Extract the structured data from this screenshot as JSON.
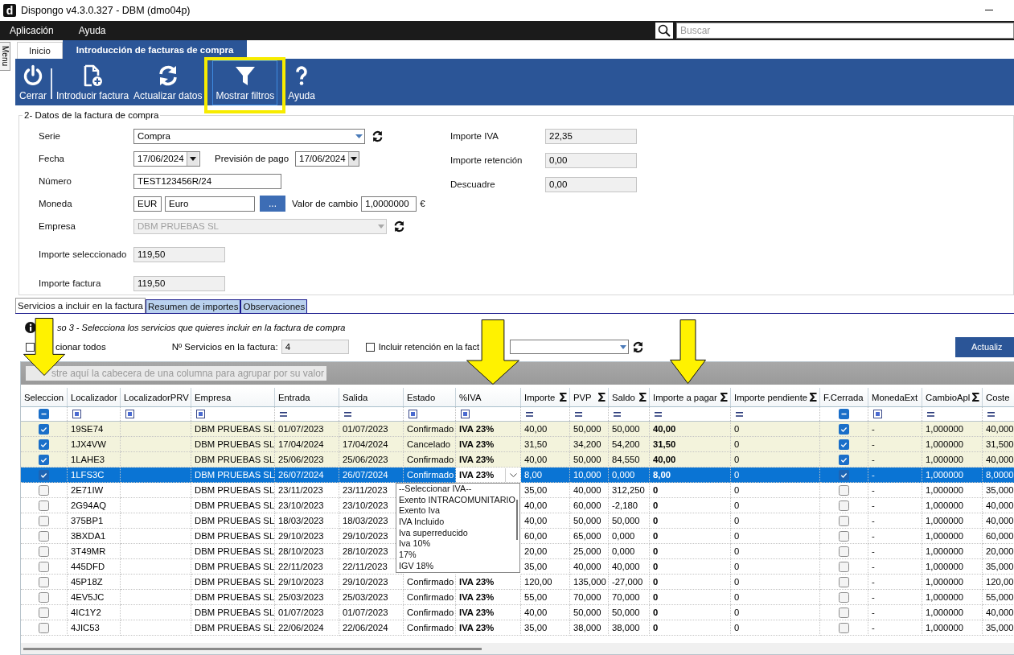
{
  "window": {
    "title": "Dispongo v4.3.0.327 - DBM (dmo04p)",
    "logo": "d"
  },
  "menu": [
    "Aplicación",
    "Ayuda"
  ],
  "search": {
    "placeholder": "Buscar"
  },
  "side_tab": "Menu",
  "tabs": [
    {
      "label": "Inicio",
      "selected": false
    },
    {
      "label": "Introducción de facturas de compra",
      "selected": true
    }
  ],
  "toolbar": [
    {
      "kind": "power",
      "label": "Cerrar",
      "highlighted": false
    },
    {
      "kind": "separator"
    },
    {
      "kind": "new-doc",
      "label": "Introducir factura",
      "highlighted": false
    },
    {
      "kind": "refresh",
      "label": "Actualizar datos",
      "highlighted": false
    },
    {
      "kind": "filter",
      "label": "Mostrar filtros",
      "highlighted": true
    },
    {
      "kind": "help",
      "label": "Ayuda",
      "highlighted": false
    }
  ],
  "form": {
    "title": "2- Datos de la factura de compra",
    "serie": {
      "label": "Serie",
      "value": "Compra"
    },
    "fecha": {
      "label": "Fecha",
      "value": "17/06/2024"
    },
    "prevision": {
      "label": "Previsión de pago",
      "value": "17/06/2024"
    },
    "numero": {
      "label": "Número",
      "value": "TEST123456R/24"
    },
    "moneda": {
      "label": "Moneda",
      "code": "EUR",
      "name": "Euro",
      "button": "..."
    },
    "cambio": {
      "label": "Valor de cambio",
      "value": "1,0000000",
      "symbol": "€"
    },
    "empresa": {
      "label": "Empresa",
      "value": "DBM PRUEBAS SL",
      "disabled": true
    },
    "importe_seleccionado": {
      "label": "Importe seleccionado",
      "value": "119,50"
    },
    "importe_factura": {
      "label": "Importe factura",
      "value": "119,50"
    },
    "importe_iva": {
      "label": "Importe IVA",
      "value": "22,35"
    },
    "importe_retencion": {
      "label": "Importe retención",
      "value": "0,00"
    },
    "descuadre": {
      "label": "Descuadre",
      "value": "0,00"
    }
  },
  "lower_tabs": [
    {
      "label": "Servicios a incluir en la factura",
      "selected": true
    },
    {
      "label": "Resumen de importes",
      "selected": false
    },
    {
      "label": "Observaciones",
      "selected": false
    }
  ],
  "info": "so 3 - Selecciona los servicios que quieres incluir en la factura de compra",
  "select_all": {
    "label": "cionar todos",
    "checked": false
  },
  "service_count": {
    "label": "Nº Servicios en la factura:",
    "value": "4"
  },
  "retention": {
    "label": "Incluir retención en la fact",
    "checked": false
  },
  "update_button": "Actualiz",
  "group_panel": {
    "placeholder": "stre aquí la cabecera de una columna para agrupar por su valor"
  },
  "columns": [
    {
      "title": "Seleccion",
      "kind": "check"
    },
    {
      "title": "Localizador",
      "kind": "list"
    },
    {
      "title": "LocalizadorPRV",
      "kind": "list"
    },
    {
      "title": "Empresa",
      "kind": "list"
    },
    {
      "title": "Entrada",
      "kind": "equals"
    },
    {
      "title": "Salida",
      "kind": "equals"
    },
    {
      "title": "Estado",
      "kind": "list"
    },
    {
      "title": "%IVA",
      "kind": "list"
    },
    {
      "title": "Importe",
      "kind": "equals",
      "sum": true
    },
    {
      "title": "PVP",
      "kind": "equals",
      "sum": true
    },
    {
      "title": "Saldo",
      "kind": "equals",
      "sum": true
    },
    {
      "title": "Importe a pagar",
      "kind": "equals",
      "sum": true
    },
    {
      "title": "Importe pendiente",
      "kind": "equals",
      "sum": true
    },
    {
      "title": "F.Cerrada",
      "kind": "check"
    },
    {
      "title": "MonedaExt",
      "kind": "list"
    },
    {
      "title": "CambioApl",
      "kind": "equals",
      "sum": true
    },
    {
      "title": "Coste",
      "kind": "equals"
    }
  ],
  "rows": [
    {
      "sel": true,
      "current": false,
      "loc": "19SE74",
      "emp": "DBM PRUEBAS SL",
      "ent": "01/07/2023",
      "sal": "01/07/2023",
      "est": "Confirmado",
      "iva": "IVA 23%",
      "imp": "40,00",
      "pvp": "50,000",
      "saldo": "50,000",
      "pagar": "40,00",
      "pend": "0",
      "cerrada": true,
      "mon": "-",
      "camb": "1,000000",
      "coste": "40,000"
    },
    {
      "sel": true,
      "current": false,
      "loc": "1JX4VW",
      "emp": "DBM PRUEBAS SL",
      "ent": "17/04/2024",
      "sal": "17/04/2024",
      "est": "Cancelado",
      "iva": "IVA 23%",
      "imp": "31,50",
      "pvp": "34,200",
      "saldo": "54,200",
      "pagar": "31,50",
      "pend": "0",
      "cerrada": true,
      "mon": "-",
      "camb": "1,000000",
      "coste": "31,500"
    },
    {
      "sel": true,
      "current": false,
      "loc": "1LAHE3",
      "emp": "DBM PRUEBAS SL",
      "ent": "25/06/2023",
      "sal": "25/06/2023",
      "est": "Confirmado",
      "iva": "IVA 23%",
      "imp": "40,00",
      "pvp": "50,000",
      "saldo": "84,550",
      "pagar": "40,00",
      "pend": "0",
      "cerrada": true,
      "mon": "-",
      "camb": "1,000000",
      "coste": "40,000"
    },
    {
      "sel": true,
      "current": true,
      "loc": "1LFS3C",
      "emp": "DBM PRUEBAS SL",
      "ent": "26/07/2024",
      "sal": "26/07/2024",
      "est": "Confirmado",
      "iva": "IVA 23%",
      "imp": "8,00",
      "pvp": "10,000",
      "saldo": "0,000",
      "pagar": "8,00",
      "pend": "0",
      "cerrada": true,
      "mon": "-",
      "camb": "1,000000",
      "coste": "8,0000"
    },
    {
      "sel": false,
      "current": false,
      "loc": "2E71IW",
      "emp": "DBM PRUEBAS SL",
      "ent": "23/11/2023",
      "sal": "23/11/2023",
      "imp": "35,00",
      "pvp": "40,000",
      "saldo": "312,250",
      "pagar": "0",
      "pend": "0",
      "cerrada": false,
      "mon": "-",
      "camb": "1,000000",
      "coste": "35,000"
    },
    {
      "sel": false,
      "current": false,
      "loc": "2G94AQ",
      "emp": "DBM PRUEBAS SL",
      "ent": "23/10/2023",
      "sal": "23/10/2023",
      "imp": "40,00",
      "pvp": "60,000",
      "saldo": "-2,180",
      "pagar": "0",
      "pend": "0",
      "cerrada": false,
      "mon": "-",
      "camb": "1,000000",
      "coste": "40,000"
    },
    {
      "sel": false,
      "current": false,
      "loc": "375BP1",
      "emp": "DBM PRUEBAS SL",
      "ent": "18/03/2023",
      "sal": "18/03/2023",
      "imp": "40,00",
      "pvp": "50,000",
      "saldo": "50,000",
      "pagar": "0",
      "pend": "0",
      "cerrada": false,
      "mon": "-",
      "camb": "1,000000",
      "coste": "40,000"
    },
    {
      "sel": false,
      "current": false,
      "loc": "3BXDA1",
      "emp": "DBM PRUEBAS SL",
      "ent": "29/10/2023",
      "sal": "29/10/2023",
      "imp": "60,00",
      "pvp": "65,000",
      "saldo": "0,000",
      "pagar": "0",
      "pend": "0",
      "cerrada": false,
      "mon": "-",
      "camb": "1,000000",
      "coste": "60,000"
    },
    {
      "sel": false,
      "current": false,
      "loc": "3T49MR",
      "emp": "DBM PRUEBAS SL",
      "ent": "28/10/2023",
      "sal": "28/10/2023",
      "imp": "20,00",
      "pvp": "25,000",
      "saldo": "0,000",
      "pagar": "0",
      "pend": "0",
      "cerrada": false,
      "mon": "-",
      "camb": "1,000000",
      "coste": "20,000"
    },
    {
      "sel": false,
      "current": false,
      "loc": "445DFD",
      "emp": "DBM PRUEBAS SL",
      "ent": "22/11/2023",
      "sal": "22/11/2023",
      "imp": "35,00",
      "pvp": "40,000",
      "saldo": "40,000",
      "pagar": "0",
      "pend": "0",
      "cerrada": false,
      "mon": "-",
      "camb": "1,000000",
      "coste": "35,000"
    },
    {
      "sel": false,
      "current": false,
      "loc": "45P18Z",
      "emp": "DBM PRUEBAS SL",
      "ent": "29/10/2023",
      "sal": "29/10/2023",
      "est": "Confirmado",
      "iva": "IVA 23%",
      "imp": "120,00",
      "pvp": "135,000",
      "saldo": "-27,000",
      "pagar": "0",
      "pend": "0",
      "cerrada": false,
      "mon": "-",
      "camb": "1,000000",
      "coste": "120,00"
    },
    {
      "sel": false,
      "current": false,
      "loc": "4EV5JC",
      "emp": "DBM PRUEBAS SL",
      "ent": "25/03/2023",
      "sal": "25/03/2023",
      "est": "Confirmado",
      "iva": "IVA 23%",
      "imp": "55,00",
      "pvp": "70,000",
      "saldo": "70,000",
      "pagar": "0",
      "pend": "0",
      "cerrada": false,
      "mon": "-",
      "camb": "1,000000",
      "coste": "55,000"
    },
    {
      "sel": false,
      "current": false,
      "loc": "4IC1Y2",
      "emp": "DBM PRUEBAS SL",
      "ent": "01/07/2023",
      "sal": "01/07/2023",
      "est": "Confirmado",
      "iva": "IVA 23%",
      "imp": "40,00",
      "pvp": "50,000",
      "saldo": "50,000",
      "pagar": "0",
      "pend": "0",
      "cerrada": false,
      "mon": "-",
      "camb": "1,000000",
      "coste": "40,000"
    },
    {
      "sel": false,
      "current": false,
      "loc": "4JIC53",
      "emp": "DBM PRUEBAS SL",
      "ent": "22/06/2024",
      "sal": "22/06/2024",
      "est": "Confirmado",
      "iva": "IVA 23%",
      "imp": "35,00",
      "pvp": "38,000",
      "saldo": "38,000",
      "pagar": "0",
      "pend": "0",
      "cerrada": false,
      "mon": "-",
      "camb": "1,000000",
      "coste": "35,000"
    }
  ],
  "iva_dropdown": {
    "options": [
      "--Seleccionar IVA--",
      "Exento INTRACOMUNITARIO",
      "Exento Iva",
      "IVA Incluido",
      "Iva superreducido",
      "Iva 10%",
      "17%",
      "IGV 18%"
    ]
  }
}
